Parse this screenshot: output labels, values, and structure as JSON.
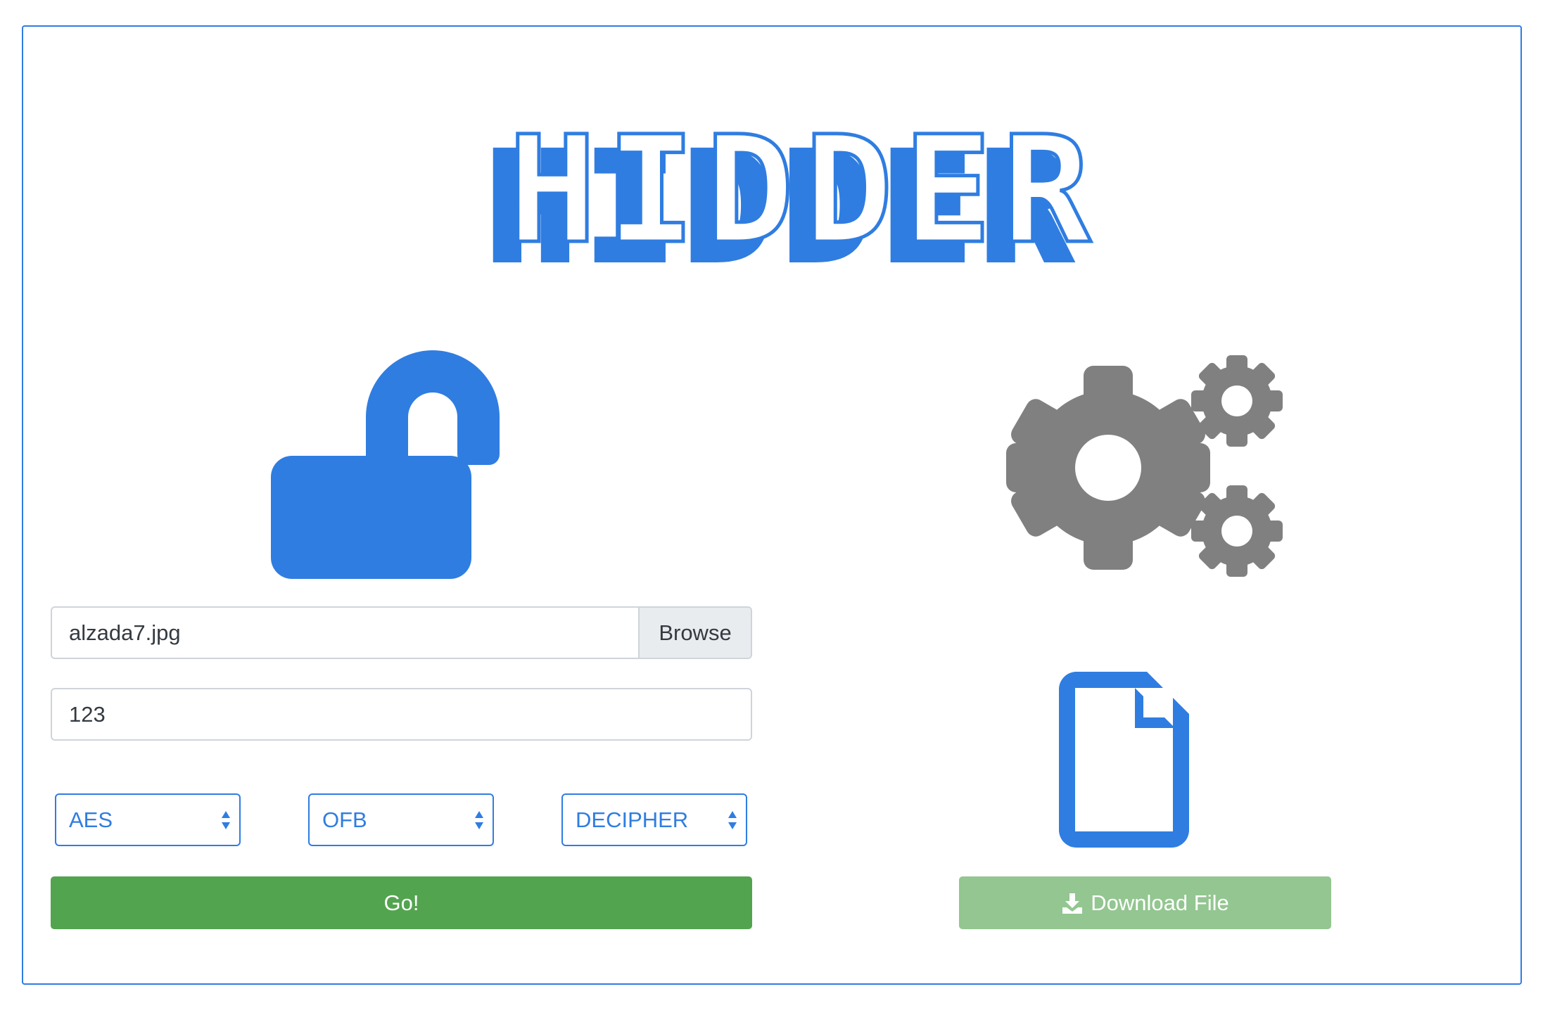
{
  "app": {
    "title": "HIDDER"
  },
  "upload": {
    "file_value": "alzada7.jpg",
    "browse_label": "Browse",
    "key_value": "123"
  },
  "options": {
    "algorithm": "AES",
    "mode": "OFB",
    "operation": "DECIPHER"
  },
  "actions": {
    "go_label": "Go!",
    "download_label": "Download File"
  },
  "icons": {
    "status": "unlocked-lock-icon",
    "processing": "gears-icon",
    "output": "file-icon",
    "download": "download-icon"
  },
  "colors": {
    "primary": "#2f7de1",
    "success": "#53a44f",
    "success_disabled": "#93c690",
    "gear_gray": "#808080"
  }
}
